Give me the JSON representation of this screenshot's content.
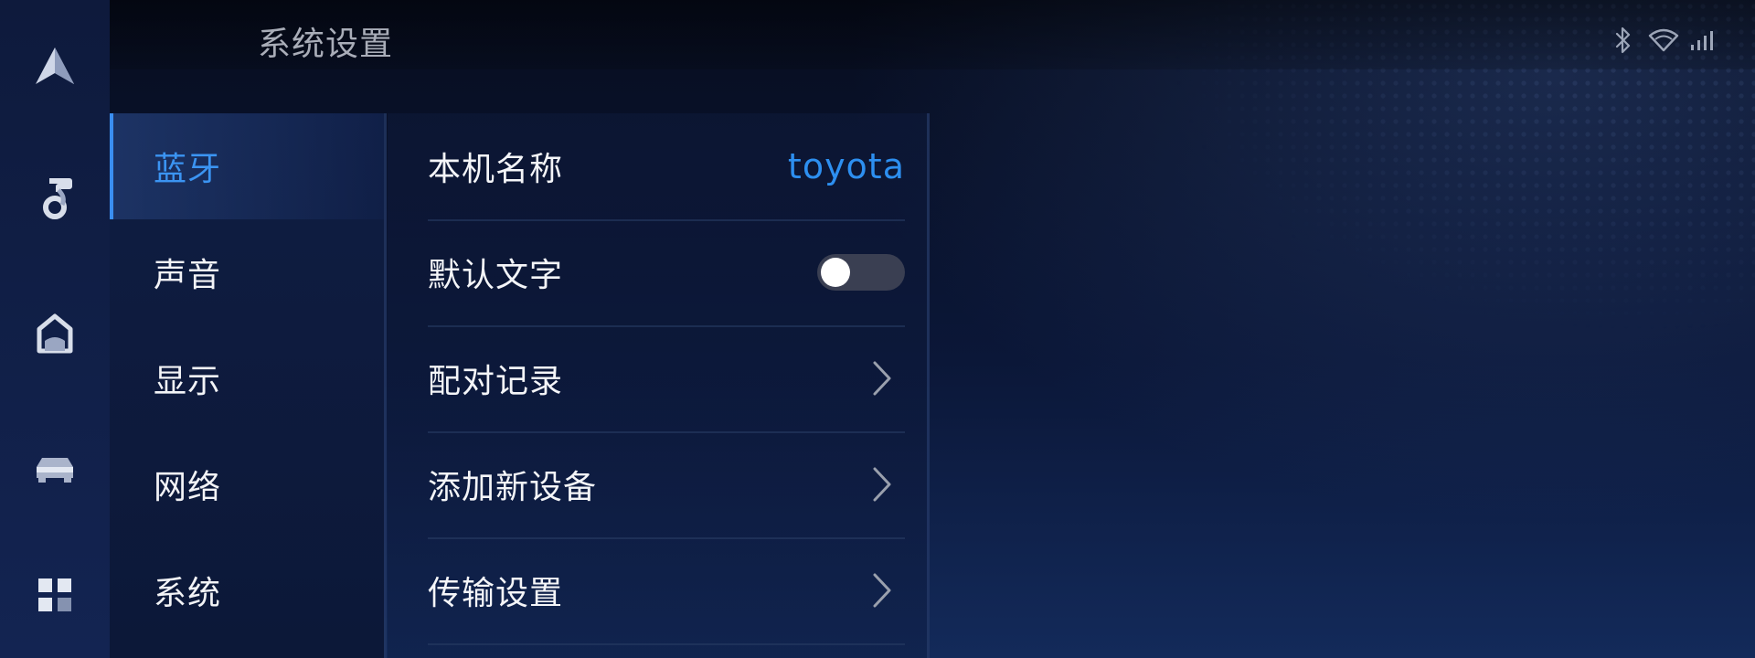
{
  "header": {
    "title": "系统设置"
  },
  "status_icons": [
    "bluetooth-icon",
    "wifi-icon",
    "signal-icon"
  ],
  "nav_rail": [
    {
      "name": "navigation-icon"
    },
    {
      "name": "music-icon"
    },
    {
      "name": "home-icon"
    },
    {
      "name": "car-icon"
    },
    {
      "name": "apps-icon"
    }
  ],
  "categories": {
    "selected": 0,
    "items": [
      {
        "label": "蓝牙"
      },
      {
        "label": "声音"
      },
      {
        "label": "显示"
      },
      {
        "label": "网络"
      },
      {
        "label": "系统"
      }
    ]
  },
  "bluetooth": {
    "device_name": {
      "label": "本机名称",
      "value": "toyota"
    },
    "default_text": {
      "label": "默认文字",
      "enabled": false
    },
    "pairing_history": {
      "label": "配对记录"
    },
    "add_device": {
      "label": "添加新设备"
    },
    "transfer_settings": {
      "label": "传输设置"
    }
  },
  "colors": {
    "accent": "#3b94f2",
    "value_text": "#2d8ff0",
    "toggle_off": "#3a3f52",
    "background": "#0b1738"
  }
}
